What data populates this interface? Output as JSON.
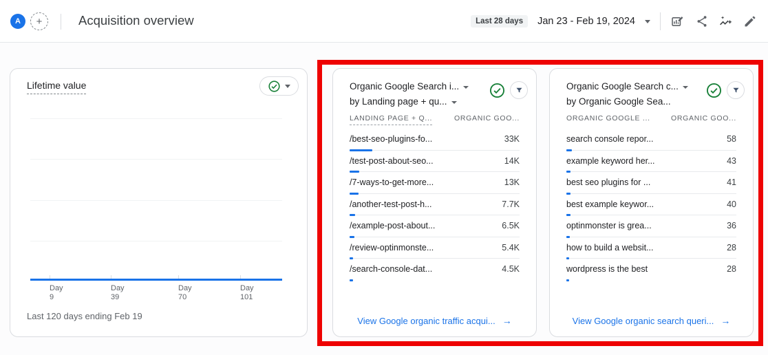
{
  "header": {
    "avatar_letter": "A",
    "add_comparison": "+",
    "title": "Acquisition overview",
    "range_badge": "Last 28 days",
    "date_range": "Jan 23 - Feb 19, 2024"
  },
  "misc": {
    "arrow": "→"
  },
  "colors": {
    "accent_blue": "#1a73e8",
    "check_green": "#188038",
    "highlight_red": "#ee0202",
    "icon_gray": "#5f6368"
  },
  "lifetime_card": {
    "title": "Lifetime value",
    "ticks": [
      {
        "top": "Day",
        "bottom": "9"
      },
      {
        "top": "Day",
        "bottom": "39"
      },
      {
        "top": "Day",
        "bottom": "70"
      },
      {
        "top": "Day",
        "bottom": "101"
      }
    ],
    "footnote": "Last 120 days ending Feb 19"
  },
  "traffic_card": {
    "title": "Organic Google Search i...",
    "subtitle": "by Landing page + qu...",
    "columns": [
      "LANDING PAGE + Q...",
      "ORGANIC GOO..."
    ],
    "bar_unit": 0.001,
    "rows": [
      {
        "label": "/best-seo-plugins-fo...",
        "value": "33K",
        "num": 33000
      },
      {
        "label": "/test-post-about-seo...",
        "value": "14K",
        "num": 14000
      },
      {
        "label": "/7-ways-to-get-more...",
        "value": "13K",
        "num": 13000
      },
      {
        "label": "/another-test-post-h...",
        "value": "7.7K",
        "num": 7700
      },
      {
        "label": "/example-post-about...",
        "value": "6.5K",
        "num": 6500
      },
      {
        "label": "/review-optinmonste...",
        "value": "5.4K",
        "num": 5400
      },
      {
        "label": "/search-console-dat...",
        "value": "4.5K",
        "num": 4500
      }
    ],
    "link": "View Google organic traffic acqui..."
  },
  "queries_card": {
    "title": "Organic Google Search c...",
    "subtitle": "by Organic Google Sea...",
    "columns": [
      "ORGANIC GOOGLE ...",
      "ORGANIC GOO..."
    ],
    "bar_unit": 0.138,
    "rows": [
      {
        "label": "search console repor...",
        "value": "58",
        "num": 58
      },
      {
        "label": "example keyword her...",
        "value": "43",
        "num": 43
      },
      {
        "label": "best seo plugins for ...",
        "value": "41",
        "num": 41
      },
      {
        "label": "best example keywor...",
        "value": "40",
        "num": 40
      },
      {
        "label": "optinmonster is grea...",
        "value": "36",
        "num": 36
      },
      {
        "label": "how to build a websit...",
        "value": "28",
        "num": 28
      },
      {
        "label": "wordpress is the best",
        "value": "28",
        "num": 28
      }
    ],
    "link": "View Google organic search queri..."
  }
}
